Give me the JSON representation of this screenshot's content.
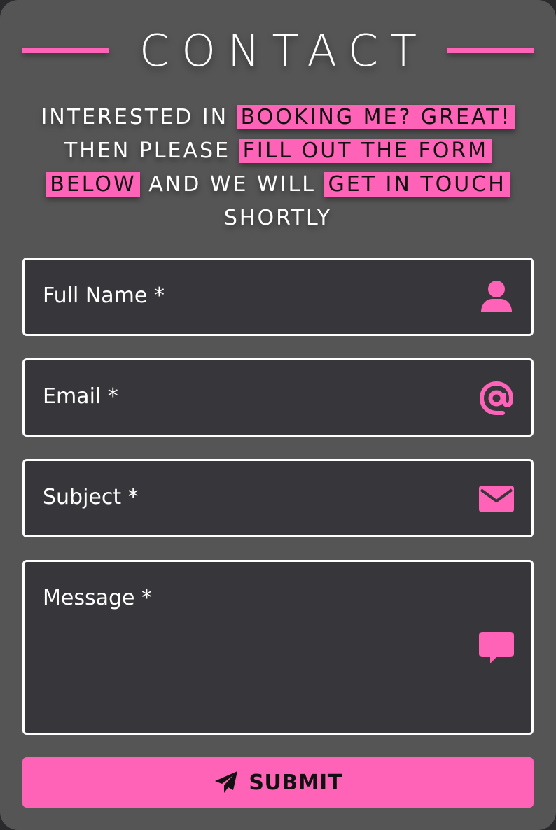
{
  "title": "CONTACT",
  "intro": {
    "p1": "INTERESTED IN ",
    "h1": "BOOKING ME? GREAT!",
    "p2": " THEN PLEASE ",
    "h2": "FILL OUT THE FORM BELOW",
    "p3": " AND WE WILL ",
    "h3": "GET IN TOUCH",
    "p4": " SHORTLY"
  },
  "form": {
    "full_name": {
      "placeholder": "Full Name *",
      "value": "",
      "icon": "user-icon"
    },
    "email": {
      "placeholder": "Email *",
      "value": "",
      "icon": "at-sign-icon"
    },
    "subject": {
      "placeholder": "Subject *",
      "value": "",
      "icon": "envelope-icon"
    },
    "message": {
      "placeholder": "Message *",
      "value": "",
      "icon": "speech-bubble-icon"
    }
  },
  "submit": {
    "label": "SUBMIT",
    "icon": "paper-plane-icon"
  },
  "colors": {
    "accent": "#ff63b8",
    "card_background": "#555555",
    "field_background": "#37373b",
    "field_border": "#ffffff",
    "text": "#ffffff"
  }
}
